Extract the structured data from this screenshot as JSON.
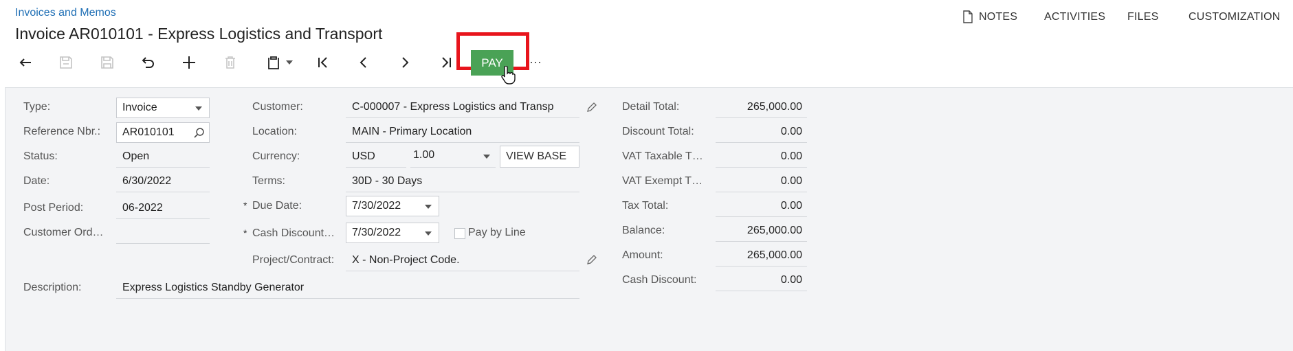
{
  "breadcrumb": "Invoices and Memos",
  "title": "Invoice AR010101 - Express Logistics and Transport",
  "top_actions": {
    "notes": "NOTES",
    "activities": "ACTIVITIES",
    "files": "FILES",
    "customization": "CUSTOMIZATION"
  },
  "toolbar": {
    "pay": "PAY",
    "more": "···"
  },
  "form": {
    "type_label": "Type:",
    "type_value": "Invoice",
    "ref_label": "Reference Nbr.:",
    "ref_value": "AR010101",
    "status_label": "Status:",
    "status_value": "Open",
    "date_label": "Date:",
    "date_value": "6/30/2022",
    "post_label": "Post Period:",
    "post_value": "06-2022",
    "custord_label": "Customer Ord…",
    "custord_value": "",
    "desc_label": "Description:",
    "desc_value": "Express Logistics Standby Generator",
    "customer_label": "Customer:",
    "customer_value": "C-000007 - Express Logistics and Transp",
    "location_label": "Location:",
    "location_value": "MAIN - Primary Location",
    "currency_label": "Currency:",
    "currency_value": "USD",
    "rate_value": "1.00",
    "view_base": "VIEW BASE",
    "terms_label": "Terms:",
    "terms_value": "30D - 30 Days",
    "due_label": "Due Date:",
    "due_value": "7/30/2022",
    "cashdisc_label": "Cash Discount…",
    "cashdisc_value": "7/30/2022",
    "paybyline_label": "Pay by Line",
    "project_label": "Project/Contract:",
    "project_value": "X - Non-Project Code."
  },
  "totals": [
    {
      "label": "Detail Total:",
      "value": "265,000.00"
    },
    {
      "label": "Discount Total:",
      "value": "0.00"
    },
    {
      "label": "VAT Taxable T…",
      "value": "0.00"
    },
    {
      "label": "VAT Exempt T…",
      "value": "0.00"
    },
    {
      "label": "Tax Total:",
      "value": "0.00"
    },
    {
      "label": "Balance:",
      "value": "265,000.00"
    },
    {
      "label": "Amount:",
      "value": "265,000.00"
    },
    {
      "label": "Cash Discount:",
      "value": "0.00"
    }
  ]
}
